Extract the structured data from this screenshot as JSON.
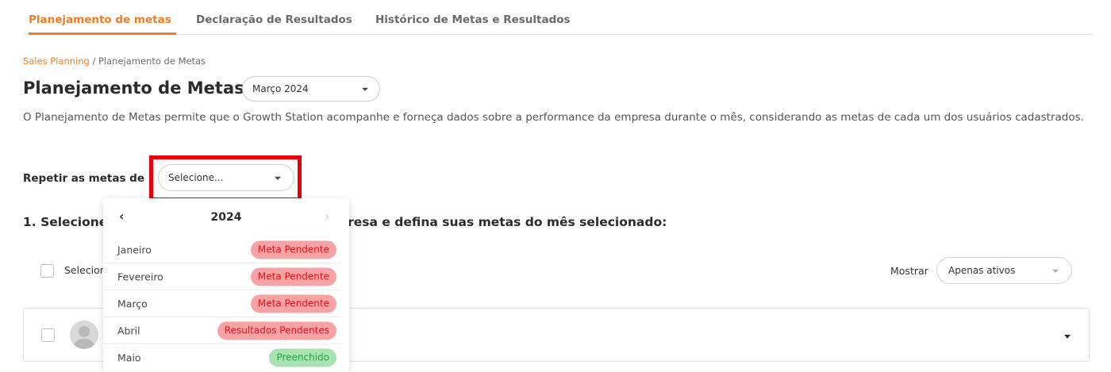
{
  "tabs": [
    {
      "label": "Planejamento de metas",
      "active": true
    },
    {
      "label": "Declaração de Resultados",
      "active": false
    },
    {
      "label": "Histórico de Metas e Resultados",
      "active": false
    }
  ],
  "breadcrumb": {
    "link": "Sales Planning",
    "separator": " / ",
    "current": "Planejamento de Metas"
  },
  "page_title": "Planejamento de Metas",
  "month_select": {
    "value": "Março 2024"
  },
  "description": "O Planejamento de Metas permite que o Growth Station acompanhe e forneça dados sobre a performance da empresa durante o mês, considerando as metas de cada um dos usuários cadastrados.",
  "repeat": {
    "label": "Repetir as metas de",
    "placeholder": "Selecione..."
  },
  "step_title": {
    "start": "1. Selecione",
    "end": "presa e defina suas metas do mês selecionado:"
  },
  "select_all_label": "Selecior",
  "filter": {
    "label": "Mostrar",
    "value": "Apenas ativos"
  },
  "calendar": {
    "prev_icon": "‹",
    "next_icon": "›",
    "year": "2024",
    "months": [
      {
        "name": "Janeiro",
        "status": "Meta Pendente",
        "type": "pending"
      },
      {
        "name": "Fevereiro",
        "status": "Meta Pendente",
        "type": "pending"
      },
      {
        "name": "Março",
        "status": "Meta Pendente",
        "type": "pending"
      },
      {
        "name": "Abril",
        "status": "Resultados Pendentes",
        "type": "pending"
      },
      {
        "name": "Maio",
        "status": "Preenchido",
        "type": "filled"
      }
    ]
  },
  "colors": {
    "accent": "#f07c23",
    "highlight": "#e8000b",
    "pending_bg": "#f6a3a6",
    "pending_text": "#e0141c",
    "filled_bg": "#a9e2b3",
    "filled_text": "#26a23a"
  }
}
